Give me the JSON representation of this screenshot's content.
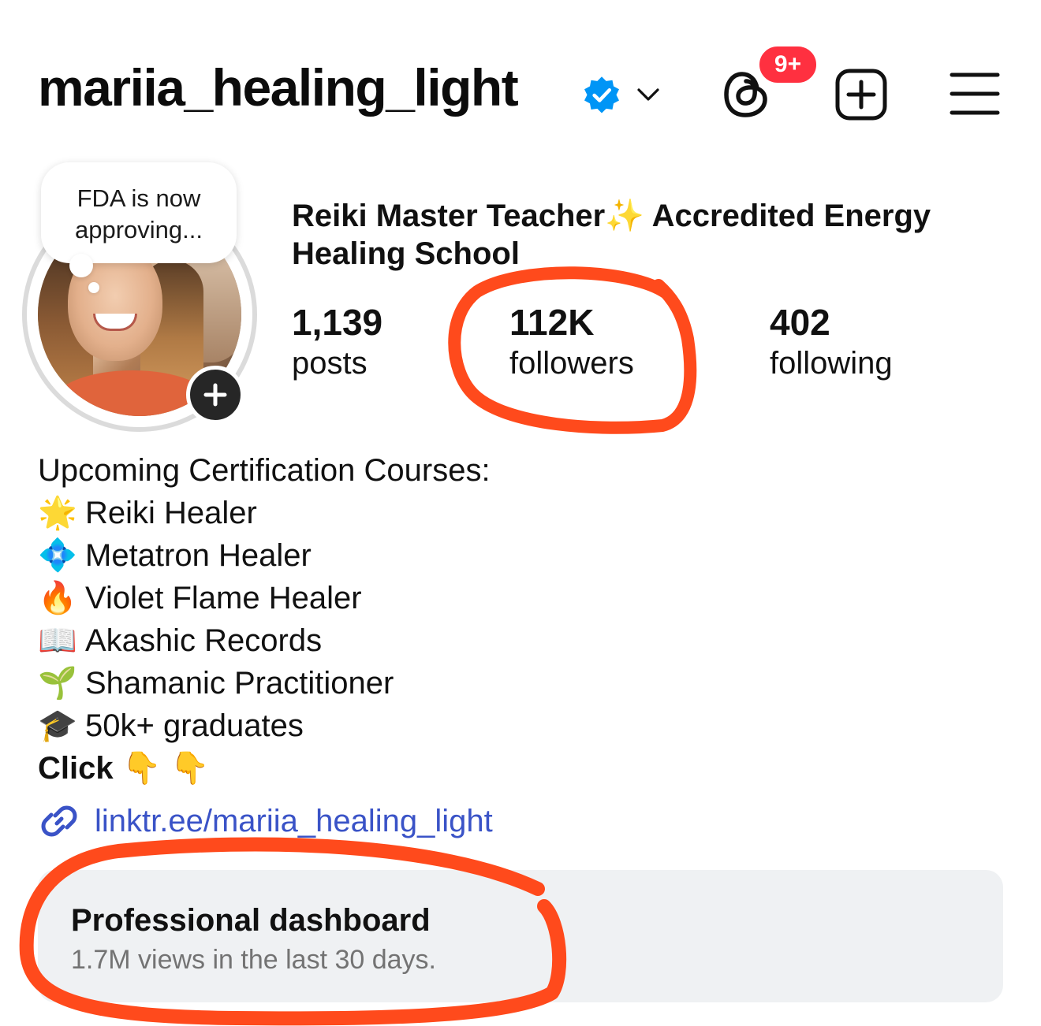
{
  "header": {
    "username": "mariia_healing_light",
    "threads_badge": "9+"
  },
  "note": {
    "text": "FDA is now approving..."
  },
  "profile": {
    "display_name": "Reiki Master Teacher✨ Accredited Energy Healing School"
  },
  "stats": [
    {
      "value": "1,139",
      "label": "posts"
    },
    {
      "value": "112K",
      "label": "followers"
    },
    {
      "value": "402",
      "label": "following"
    }
  ],
  "bio": {
    "heading": "Upcoming Certification Courses:",
    "items": [
      {
        "emoji": "🌟",
        "text": "Reiki Healer"
      },
      {
        "emoji": "💠",
        "text": "Metatron Healer"
      },
      {
        "emoji": "🔥",
        "text": "Violet Flame Healer"
      },
      {
        "emoji": "📖",
        "text": "Akashic Records"
      },
      {
        "emoji": "🌱",
        "text": "Shamanic Practitioner"
      },
      {
        "emoji": "🎓",
        "text": "50k+ graduates"
      }
    ],
    "click_label": "Click",
    "click_emojis": "👇 👇"
  },
  "link": {
    "text": "linktr.ee/mariia_healing_light"
  },
  "dashboard": {
    "title": "Professional dashboard",
    "subtitle": "1.7M views in the last 30 days."
  },
  "colors": {
    "verified": "#0095f6",
    "badge": "#ff3040",
    "link": "#3a53c7",
    "annotation": "#ff4a1c",
    "dashboard_bg": "#eff1f3"
  }
}
